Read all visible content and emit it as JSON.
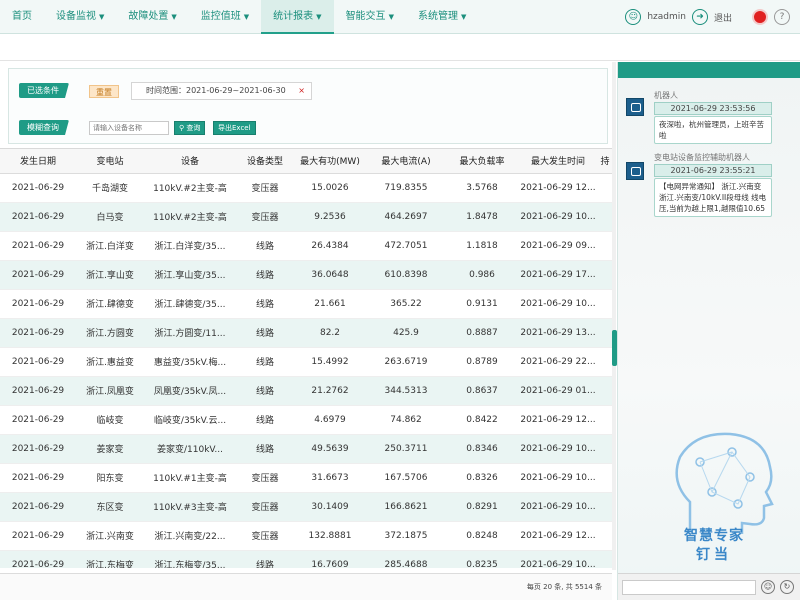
{
  "nav": {
    "items": [
      {
        "label": "首页",
        "caret": false
      },
      {
        "label": "设备监视",
        "caret": true
      },
      {
        "label": "故障处置",
        "caret": true
      },
      {
        "label": "监控值班",
        "caret": true
      },
      {
        "label": "统计报表",
        "caret": true,
        "active": true
      },
      {
        "label": "智能交互",
        "caret": true
      },
      {
        "label": "系统管理",
        "caret": true
      }
    ],
    "username": "hzadmin",
    "logout_label": "退出",
    "help_label": "?",
    "accent_color": "#1f9b86",
    "alarm_color": "#e02020"
  },
  "filter": {
    "selected_label": "已选条件",
    "reset_label": "重置",
    "condition_chip": "时间范围：2021-06-29~2021-06-30",
    "chip_close": "×",
    "query_label": "模糊查询",
    "search_placeholder": "请输入设备名称",
    "query_button": "查询",
    "export_button": "导出Excel"
  },
  "table": {
    "columns": [
      "发生日期",
      "变电站",
      "设备",
      "设备类型",
      "最大有功(MW)",
      "最大电流(A)",
      "最大负载率",
      "最大发生时间",
      "持"
    ],
    "rows": [
      [
        "2021-06-29",
        "千岛湖变",
        "110kV.#2主变-高",
        "变压器",
        "15.0026",
        "719.8355",
        "3.5768",
        "2021-06-29 12...",
        ""
      ],
      [
        "2021-06-29",
        "白马变",
        "110kV.#2主变-高",
        "变压器",
        "9.2536",
        "464.2697",
        "1.8478",
        "2021-06-29 10...",
        ""
      ],
      [
        "2021-06-29",
        "浙江.白洋变",
        "浙江.白洋变/35...",
        "线路",
        "26.4384",
        "472.7051",
        "1.1818",
        "2021-06-29 09...",
        ""
      ],
      [
        "2021-06-29",
        "浙江.享山变",
        "浙江.享山变/35...",
        "线路",
        "36.0648",
        "610.8398",
        "0.986",
        "2021-06-29 17...",
        ""
      ],
      [
        "2021-06-29",
        "浙江.肆德变",
        "浙江.肆德变/35...",
        "线路",
        "21.661",
        "365.22",
        "0.9131",
        "2021-06-29 10...",
        ""
      ],
      [
        "2021-06-29",
        "浙江.方圆变",
        "浙江.方圆变/11...",
        "线路",
        "82.2",
        "425.9",
        "0.8887",
        "2021-06-29 13...",
        ""
      ],
      [
        "2021-06-29",
        "浙江.惠益变",
        "惠益变/35kV.梅...",
        "线路",
        "15.4992",
        "263.6719",
        "0.8789",
        "2021-06-29 22...",
        ""
      ],
      [
        "2021-06-29",
        "浙江.凤凰变",
        "凤凰变/35kV.凤...",
        "线路",
        "21.2762",
        "344.5313",
        "0.8637",
        "2021-06-29 01...",
        ""
      ],
      [
        "2021-06-29",
        "临岐变",
        "临岐变/35kV.云...",
        "线路",
        "4.6979",
        "74.862",
        "0.8422",
        "2021-06-29 12...",
        ""
      ],
      [
        "2021-06-29",
        "姜家变",
        "姜家变/110kV...",
        "线路",
        "49.5639",
        "250.3711",
        "0.8346",
        "2021-06-29 10...",
        ""
      ],
      [
        "2021-06-29",
        "阳东变",
        "110kV.#1主变-高",
        "变压器",
        "31.6673",
        "167.5706",
        "0.8326",
        "2021-06-29 10...",
        ""
      ],
      [
        "2021-06-29",
        "东区变",
        "110kV.#3主变-高",
        "变压器",
        "30.1409",
        "166.8621",
        "0.8291",
        "2021-06-29 10...",
        ""
      ],
      [
        "2021-06-29",
        "浙江.兴南变",
        "浙江.兴南变/22...",
        "变压器",
        "132.8881",
        "372.1875",
        "0.8248",
        "2021-06-29 12...",
        ""
      ],
      [
        "2021-06-29",
        "浙江.东梅变",
        "浙江.东梅变/35...",
        "线路",
        "16.7609",
        "285.4688",
        "0.8235",
        "2021-06-29 10...",
        ""
      ]
    ]
  },
  "pager": {
    "text": "每页 20 条, 共 5514 条"
  },
  "chat": {
    "messages": [
      {
        "sender": "机器人",
        "time": "2021-06-29 23:53:56",
        "text": "夜深啦，杭州管理员，上班辛苦啦"
      },
      {
        "sender": "变电站设备监控辅助机器人",
        "time": "2021-06-29 23:55:21",
        "text": "【电网异常通知】 浙江.兴南变 浙江.兴南变/10kV.II段母线 线电压,当前为越上限1,越限值10.65"
      }
    ],
    "brand_line1": "智慧专家",
    "brand_line2": "钉当",
    "emoji_icon": "☺",
    "send_icon": "↻"
  }
}
